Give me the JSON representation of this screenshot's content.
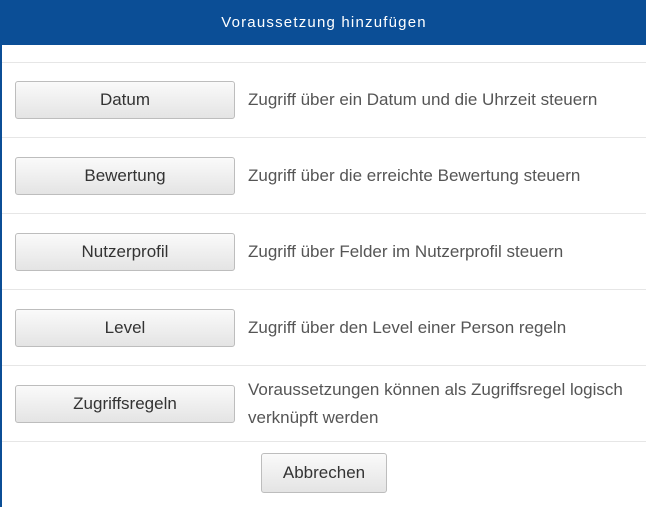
{
  "dialog": {
    "title": "Voraussetzung hinzufügen",
    "accent_color": "#0b4e96"
  },
  "options": [
    {
      "label": "Datum",
      "description": "Zugriff über ein Datum und die Uhrzeit steuern"
    },
    {
      "label": "Bewertung",
      "description": "Zugriff über die erreichte Bewertung steuern"
    },
    {
      "label": "Nutzerprofil",
      "description": "Zugriff über Felder im Nutzerprofil steuern"
    },
    {
      "label": "Level",
      "description": "Zugriff über den Level einer Person regeln"
    },
    {
      "label": "Zugriffsregeln",
      "description": "Voraussetzungen können als Zugriffsregel logisch verknüpft werden"
    }
  ],
  "footer": {
    "cancel_label": "Abbrechen"
  }
}
